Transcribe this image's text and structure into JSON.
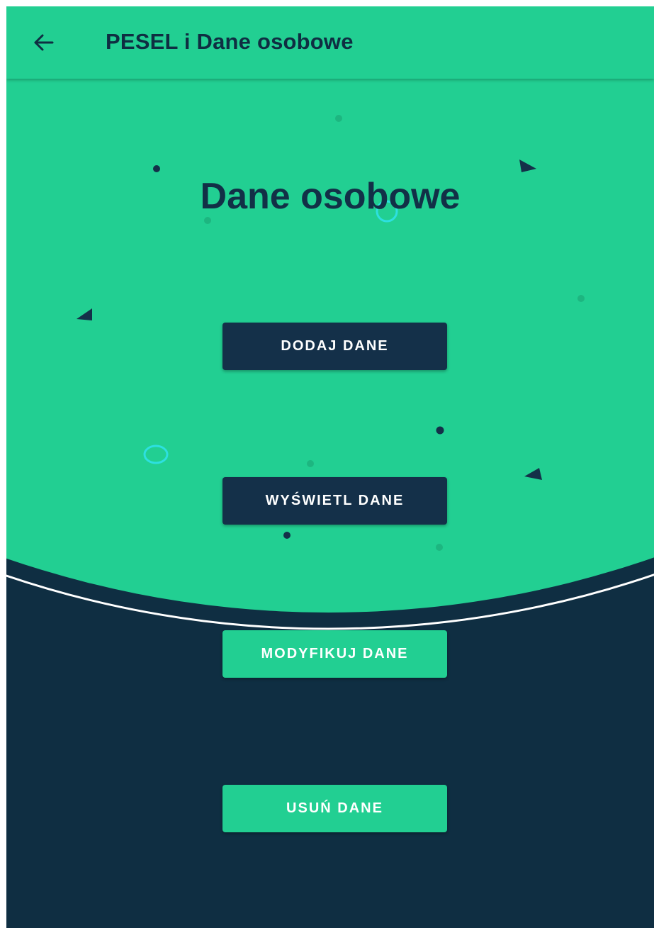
{
  "colors": {
    "accent_green": "#22cf92",
    "navy": "#0f2e42",
    "button_dark": "#143049",
    "ring_cyan": "#2de0e0",
    "white": "#ffffff"
  },
  "app_bar": {
    "back_icon": "arrow-left-icon",
    "title": "PESEL i Dane osobowe"
  },
  "main": {
    "heading": "Dane osobowe",
    "buttons": {
      "add_label": "DODAJ DANE",
      "view_label": "WYŚWIETL DANE",
      "modify_label": "MODYFIKUJ DANE",
      "delete_label": "USUŃ DANE"
    }
  },
  "decorations": {
    "shapes": [
      "dot-icon",
      "triangle-icon",
      "ring-icon"
    ]
  }
}
